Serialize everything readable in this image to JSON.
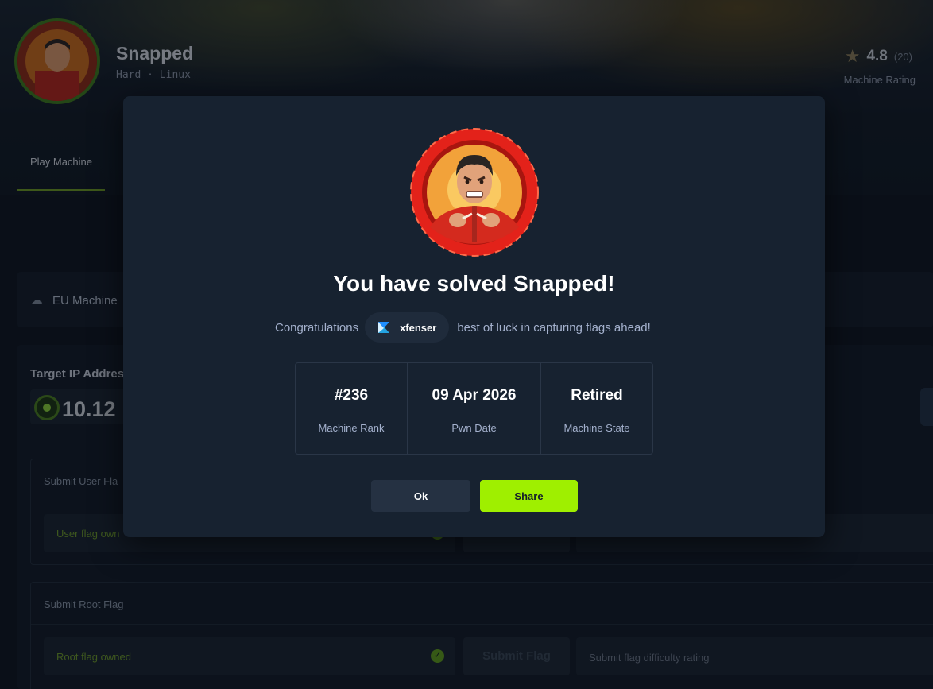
{
  "header": {
    "machine_name": "Snapped",
    "difficulty": "Hard",
    "separator": "·",
    "os": "Linux",
    "rating_value": "4.8",
    "rating_count": "(20)",
    "rating_label": "Machine Rating",
    "icons": {
      "rating": "star-icon",
      "avatar": "machine-avatar"
    }
  },
  "tabs": {
    "active": "Play Machine"
  },
  "vpn": {
    "label": "EU Machine",
    "icon": "cloud-icon"
  },
  "target": {
    "label": "Target IP Addres",
    "ip_partial": "10.12"
  },
  "user_flag": {
    "title": "Submit User Fla",
    "owned_text": "User flag own",
    "submit_label": "",
    "difficulty_placeholder": ""
  },
  "root_flag": {
    "title": "Submit Root Flag",
    "owned_text": "Root flag owned",
    "submit_label": "Submit Flag",
    "difficulty_placeholder": "Submit flag difficulty rating"
  },
  "modal": {
    "title": "You have solved Snapped!",
    "congrats_prefix": "Congratulations",
    "username": "xfenser",
    "congrats_suffix": "best of luck in capturing flags ahead!",
    "stats": [
      {
        "value": "#236",
        "label": "Machine Rank"
      },
      {
        "value": "09 Apr 2026",
        "label": "Pwn Date"
      },
      {
        "value": "Retired",
        "label": "Machine State"
      }
    ],
    "ok_label": "Ok",
    "share_label": "Share"
  },
  "colors": {
    "accent_green": "#9fef00",
    "modal_bg": "#172230",
    "page_bg": "#0f1520",
    "owned_green": "#6e9a2a"
  }
}
